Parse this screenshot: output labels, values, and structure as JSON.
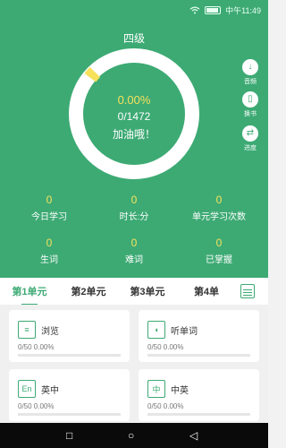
{
  "status": {
    "carrier_time": "中午11:49"
  },
  "header": {
    "title": "四级"
  },
  "progress": {
    "percent": "0.00%",
    "count": "0/1472",
    "cheer": "加油哦！",
    "fraction": 0.0
  },
  "side": [
    {
      "label": "音频",
      "glyph": "↓"
    },
    {
      "label": "换书",
      "glyph": "▯"
    },
    {
      "label": "进度",
      "glyph": "⇄"
    }
  ],
  "stats": [
    {
      "value": "0",
      "label": "今日学习"
    },
    {
      "value": "0",
      "label": "时长:分"
    },
    {
      "value": "0",
      "label": "单元学习次数"
    },
    {
      "value": "0",
      "label": "生词"
    },
    {
      "value": "0",
      "label": "难词"
    },
    {
      "value": "0",
      "label": "已掌握"
    }
  ],
  "tabs": [
    "第1单元",
    "第2单元",
    "第3单元",
    "第4单"
  ],
  "cards": [
    {
      "title": "浏览",
      "meta": "0/50  0.00%",
      "icon": "≡"
    },
    {
      "title": "听单词",
      "meta": "0/50  0.00%",
      "icon": "◖"
    },
    {
      "title": "英中",
      "meta": "0/50  0.00%",
      "icon": "En"
    },
    {
      "title": "中英",
      "meta": "0/50  0.00%",
      "icon": "中"
    }
  ],
  "nav": {
    "square": "□",
    "circle": "○",
    "back": "◁"
  }
}
